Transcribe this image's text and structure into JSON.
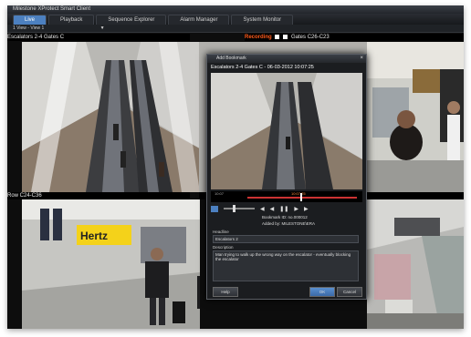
{
  "window": {
    "title": "Milestone XProtect Smart Client"
  },
  "tabs": [
    {
      "label": "Live",
      "active": true
    },
    {
      "label": "Playback"
    },
    {
      "label": "Sequence Explorer"
    },
    {
      "label": "Alarm Manager"
    },
    {
      "label": "System Monitor"
    }
  ],
  "view_selector": {
    "value": "1 View - View 1"
  },
  "cameras": {
    "cam1": {
      "title": "Escalators 2-4 Gates C"
    },
    "cam_top_right": {
      "recording": "Recording",
      "title": "Gates C26-C23"
    },
    "cam_bottom_left": {
      "title": "Row C24-C36"
    }
  },
  "dialog": {
    "title": "Add Bookmark",
    "caption": "Escalators 2-4 Gates C - 06-03-2012 10:07:25",
    "timeline": {
      "left": "10:07",
      "center": "10:07:25"
    },
    "bookmark_id": "Bookmark ID: no.000012",
    "added_by": "Added by: MILESTONE\\ERA",
    "headline_label": "Headline",
    "headline_value": "Escalators 2",
    "description_label": "Description",
    "description_value": "Man trying to walk up the wrong way on the escalator - eventually blocking the escalator",
    "buttons": {
      "help": "Help",
      "ok": "OK",
      "cancel": "Cancel"
    }
  },
  "colors": {
    "accent": "#4c80c0",
    "recording": "#ff5a1a"
  }
}
